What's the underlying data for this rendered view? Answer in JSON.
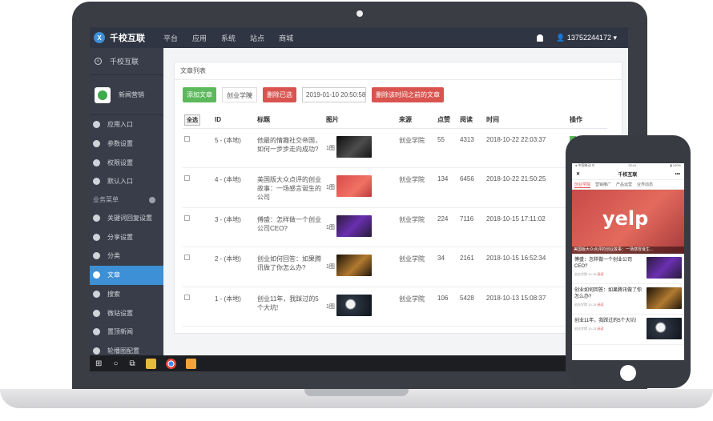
{
  "topnav": {
    "brand": "千校互联",
    "brand_logo": "X",
    "links": [
      "平台",
      "应用",
      "系统",
      "站点",
      "商城"
    ],
    "user": "13752244172 ▾"
  },
  "sidebar": {
    "back_label": "千校互联",
    "app_name": "新闻营销",
    "items_top": [
      "应用入口",
      "参数设置",
      "权限设置",
      "默认入口"
    ],
    "section_label": "业务菜单",
    "items_business": [
      "关键词回复设置",
      "分享设置",
      "分类",
      "文章",
      "搜索",
      "微站设置",
      "置顶新闻",
      "轮播图配置"
    ]
  },
  "panel": {
    "title": "文章列表",
    "add_button": "添加文章",
    "category_select": "创业学院",
    "delete_selected": "删除已选",
    "date_value": "2019-01-10 20:50:58",
    "delete_before": "删除该时间之前的文章",
    "headers": {
      "select_all": "全选",
      "id": "ID",
      "title": "标题",
      "image": "图片",
      "source": "来源",
      "likes": "点赞",
      "reads": "阅读",
      "time": "时间",
      "ops": "操作"
    },
    "rows": [
      {
        "id": "5 - (本地)",
        "title": "他最的情趣社交帝国，如何一步步走向成功?",
        "img_count": "1图",
        "source": "创业学院",
        "likes": "55",
        "reads": "4313",
        "time": "2018-10-22 22:03:37"
      },
      {
        "id": "4 - (本地)",
        "title": "美国版大众点评的创业故事：一场感言诞生的公司",
        "img_count": "1图",
        "source": "创业学院",
        "likes": "134",
        "reads": "6456",
        "time": "2018-10-22 21:50:25"
      },
      {
        "id": "3 - (本地)",
        "title": "傅盛：怎样做一个创业公司CEO?",
        "img_count": "1图",
        "source": "创业学院",
        "likes": "224",
        "reads": "7116",
        "time": "2018-10-15 17:11:02"
      },
      {
        "id": "2 - (本地)",
        "title": "创业如何回答：如果腾讯做了你怎么办?",
        "img_count": "1图",
        "source": "创业学院",
        "likes": "34",
        "reads": "2161",
        "time": "2018-10-15 16:52:34"
      },
      {
        "id": "1 - (本地)",
        "title": "创业11年，我踩过的5个大坑!",
        "img_count": "1图",
        "source": "创业学院",
        "likes": "106",
        "reads": "5428",
        "time": "2018-10-13 15:08:37"
      }
    ]
  },
  "taskbar": {
    "windows_icon": "⊞",
    "search_icon": "○",
    "taskview_icon": "⧉",
    "tray_icons": "⚡ ^ ☁ ■ ◁ ⌨ ✉"
  },
  "phone": {
    "status_left": "● 中国移动 ☰",
    "status_time": "20:41",
    "status_right": "▮ 100%",
    "header_close": "✕",
    "header_title": "千校互联",
    "header_more": "•••",
    "tabs": [
      "创业学院",
      "营销推广",
      "产品运营",
      "业界动态"
    ],
    "banner_text": "yelp",
    "banner_caption": "美国版大众点评的创业故事：一场感冒诞生...",
    "items": [
      {
        "title": "傅盛：怎样做一个创业公司CEO?",
        "meta": "创业学院",
        "date": "10-15",
        "tag": "阅读"
      },
      {
        "title": "创业如何回答：如果腾讯做了你怎么办?",
        "meta": "创业学院",
        "date": "10-15",
        "tag": "阅读"
      },
      {
        "title": "创业11年，我踩过的5个大坑!",
        "meta": "创业学院",
        "date": "10-13",
        "tag": "阅读"
      }
    ]
  }
}
